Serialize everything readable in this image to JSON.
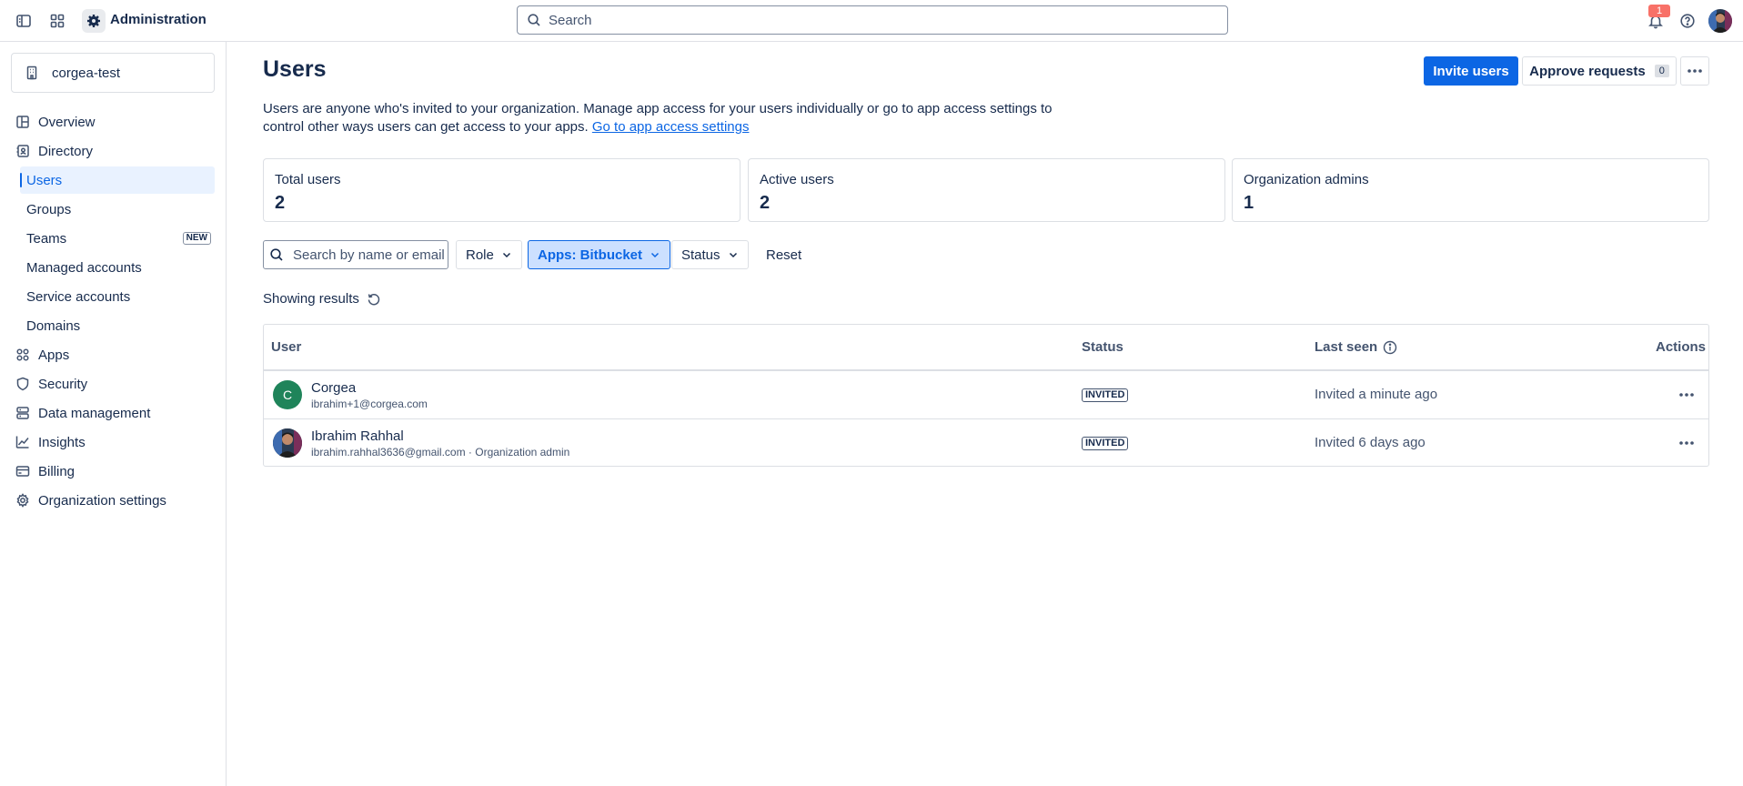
{
  "topbar": {
    "app_title": "Administration",
    "search_placeholder": "Search",
    "notification_count": "1",
    "icons": [
      "sidebar-toggle-icon",
      "app-switcher-icon",
      "gear-icon",
      "search-icon",
      "bell-icon",
      "help-icon",
      "avatar"
    ]
  },
  "sidebar": {
    "org_name": "corgea-test",
    "items": [
      {
        "label": "Overview",
        "icon": "overview-icon"
      },
      {
        "label": "Directory",
        "icon": "directory-icon"
      },
      {
        "label": "Users",
        "active": true
      },
      {
        "label": "Groups"
      },
      {
        "label": "Teams",
        "badge": "NEW"
      },
      {
        "label": "Managed accounts"
      },
      {
        "label": "Service accounts"
      },
      {
        "label": "Domains"
      },
      {
        "label": "Apps",
        "icon": "apps-icon"
      },
      {
        "label": "Security",
        "icon": "shield-icon"
      },
      {
        "label": "Data management",
        "icon": "database-icon"
      },
      {
        "label": "Insights",
        "icon": "chart-line-icon"
      },
      {
        "label": "Billing",
        "icon": "credit-card-icon"
      },
      {
        "label": "Organization settings",
        "icon": "gear-icon"
      }
    ]
  },
  "main": {
    "title": "Users",
    "invite_label": "Invite users",
    "approve_label": "Approve requests",
    "approve_count": "0",
    "description": "Users are anyone who's invited to your organization. Manage app access for your users individually or go to app access settings to control other ways users can get access to your apps.",
    "description_link": "Go to app access settings",
    "stats": [
      {
        "label": "Total users",
        "value": "2"
      },
      {
        "label": "Active users",
        "value": "2"
      },
      {
        "label": "Organization admins",
        "value": "1"
      }
    ],
    "filters": {
      "search_placeholder": "Search by name or email",
      "role_label": "Role",
      "apps_label": "Apps: Bitbucket",
      "status_label": "Status",
      "reset_label": "Reset"
    },
    "showing_label": "Showing results",
    "table": {
      "columns": [
        "User",
        "Status",
        "Last seen",
        "Actions"
      ],
      "rows": [
        {
          "avatar_initial": "C",
          "avatar_color": "#1f845a",
          "name": "Corgea",
          "meta": "ibrahim+1@corgea.com",
          "status": "INVITED",
          "last_seen": "Invited a minute ago"
        },
        {
          "avatar_initial": "",
          "name": "Ibrahim Rahhal",
          "meta": "ibrahim.rahhal3636@gmail.com · Organization admin",
          "status": "INVITED",
          "last_seen": "Invited 6 days ago"
        }
      ]
    }
  },
  "colors": {
    "primary": "#0c66e4",
    "selected_bg": "#e9f2ff",
    "filter_selected_bg": "#cce0ff",
    "text": "#172b4d",
    "subtle": "#44546f",
    "border": "#dcdfe4",
    "badge": "#f87168"
  }
}
